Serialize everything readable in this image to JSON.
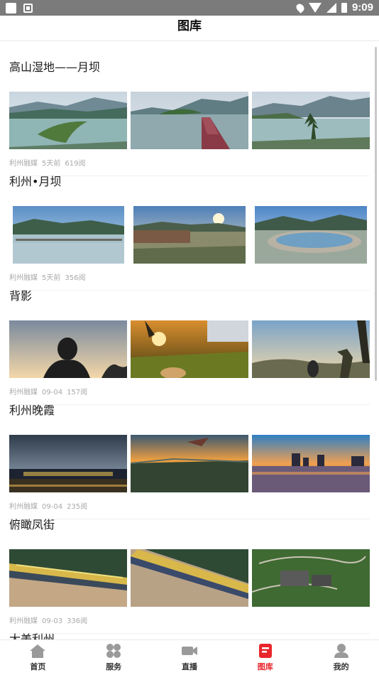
{
  "status_bar": {
    "time": "9:09"
  },
  "app_bar": {
    "title": "图库"
  },
  "gallery": [
    {
      "title": "高山湿地——月坝",
      "source": "利州融媒",
      "time": "5天前",
      "views": "619阅"
    },
    {
      "title": "利州•月坝",
      "source": "利州融媒",
      "time": "5天前",
      "views": "356阅"
    },
    {
      "title": "背影",
      "source": "利州融媒",
      "time": "09-04",
      "views": "157阅"
    },
    {
      "title": "利州晚霞",
      "source": "利州融媒",
      "time": "09-04",
      "views": "235阅"
    },
    {
      "title": "俯瞰凤街",
      "source": "利州融媒",
      "time": "09-03",
      "views": "336阅"
    },
    {
      "title": "大美利州",
      "source": "",
      "time": "",
      "views": ""
    }
  ],
  "tab_bar": {
    "items": [
      {
        "label": "首页",
        "icon": "home-icon"
      },
      {
        "label": "服务",
        "icon": "grid-icon"
      },
      {
        "label": "直播",
        "icon": "video-camera-icon"
      },
      {
        "label": "图库",
        "icon": "gallery-icon"
      },
      {
        "label": "我的",
        "icon": "user-icon"
      }
    ],
    "active_index": 3,
    "active_color": "#e8262c",
    "inactive_color": "#9a9a9a"
  }
}
